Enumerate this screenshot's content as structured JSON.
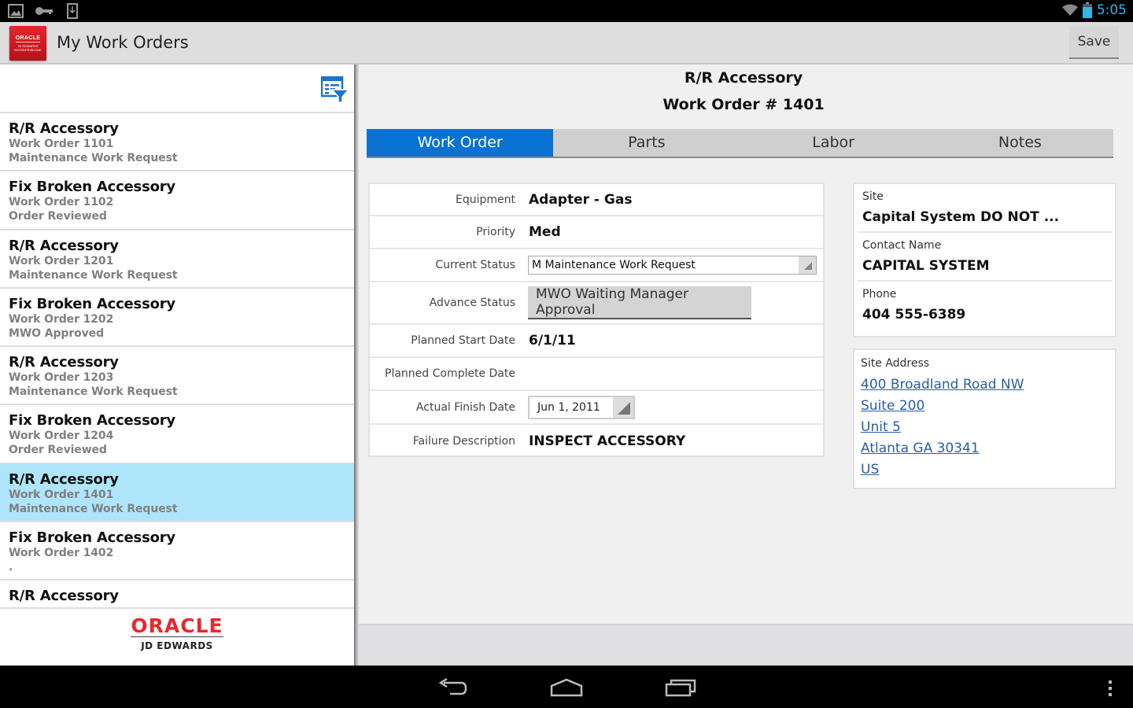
{
  "status_bar": {
    "left_icons": [
      "gallery-icon",
      "key-icon",
      "download-icon"
    ],
    "right_icons": [
      "wifi-icon",
      "battery-icon"
    ],
    "time": "5:05",
    "accent": "#33b5e5"
  },
  "action_bar": {
    "logo": {
      "line1": "ORACLE",
      "line2": "JD EDWARDS ENTERPRISEONE"
    },
    "title": "My Work Orders",
    "save_label": "Save"
  },
  "sidebar": {
    "filter_icon": "filter-list-icon",
    "items": [
      {
        "title": "R/R Accessory",
        "work_order": "Work Order 1101",
        "status": "Maintenance Work Request",
        "selected": false
      },
      {
        "title": "Fix Broken Accessory",
        "work_order": "Work Order 1102",
        "status": "Order Reviewed",
        "selected": false
      },
      {
        "title": "R/R Accessory",
        "work_order": "Work Order 1201",
        "status": "Maintenance Work Request",
        "selected": false
      },
      {
        "title": "Fix Broken Accessory",
        "work_order": "Work Order 1202",
        "status": "MWO Approved",
        "selected": false
      },
      {
        "title": "R/R Accessory",
        "work_order": "Work Order 1203",
        "status": "Maintenance Work Request",
        "selected": false
      },
      {
        "title": "Fix Broken Accessory",
        "work_order": "Work Order 1204",
        "status": "Order Reviewed",
        "selected": false
      },
      {
        "title": "R/R Accessory",
        "work_order": "Work Order 1401",
        "status": "Maintenance Work Request",
        "selected": true
      },
      {
        "title": "Fix Broken Accessory",
        "work_order": "Work Order 1402",
        "status": ".",
        "selected": false
      },
      {
        "title": "R/R Accessory",
        "work_order": "",
        "status": "",
        "selected": false
      }
    ],
    "footer": {
      "brand": "ORACLE",
      "product": "JD EDWARDS"
    }
  },
  "detail": {
    "title": "R/R Accessory",
    "subtitle": "Work Order # 1401",
    "tabs": [
      {
        "label": "Work Order",
        "active": true
      },
      {
        "label": "Parts",
        "active": false
      },
      {
        "label": "Labor",
        "active": false
      },
      {
        "label": "Notes",
        "active": false
      }
    ],
    "form": {
      "equipment": {
        "label": "Equipment",
        "value": "Adapter - Gas"
      },
      "priority": {
        "label": "Priority",
        "value": "Med"
      },
      "current_status": {
        "label": "Current Status",
        "value": "M Maintenance Work Request"
      },
      "advance_status": {
        "label": "Advance Status",
        "button": "MWO Waiting Manager Approval"
      },
      "planned_start": {
        "label": "Planned Start Date",
        "value": "6/1/11"
      },
      "planned_complete": {
        "label": "Planned Complete Date",
        "value": ""
      },
      "actual_finish": {
        "label": "Actual Finish Date",
        "value": "Jun 1, 2011"
      },
      "failure_description": {
        "label": "Failure Description",
        "value": "INSPECT ACCESSORY"
      }
    },
    "site_info": {
      "site": {
        "label": "Site",
        "value": "Capital System DO NOT ..."
      },
      "contact": {
        "label": "Contact Name",
        "value": "CAPITAL SYSTEM"
      },
      "phone": {
        "label": "Phone",
        "value": "404 555-6389"
      }
    },
    "site_address": {
      "label": "Site Address",
      "lines": [
        "400 Broadland Road NW",
        "Suite 200",
        "Unit 5",
        "Atlanta GA 30341",
        "US"
      ]
    }
  },
  "colors": {
    "tab_active": "#0a72d2",
    "selected_row": "#aee5fb",
    "link": "#2a5da8",
    "oracle_red": "#e8282c"
  },
  "nav_bar": {
    "buttons": [
      "back-icon",
      "home-icon",
      "recent-apps-icon",
      "overflow-menu-icon"
    ]
  }
}
